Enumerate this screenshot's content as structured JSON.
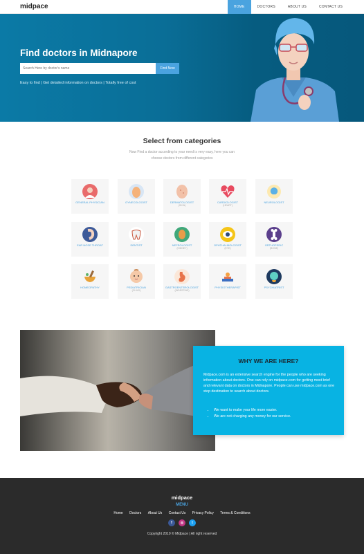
{
  "brand": "midpace",
  "nav": {
    "items": [
      "HOME",
      "DOCTORS",
      "ABOUT US",
      "CONTACT US"
    ],
    "active": "HOME"
  },
  "hero": {
    "title": "Find doctors in Midnapore",
    "search_placeholder": "Search Here by doctor's name",
    "search_button": "Find Now",
    "subtitle": "Easy to find | Get detailed information on doctors | Totally free of cost"
  },
  "categories": {
    "title": "Select from categories",
    "description": "Now Find a doctor according to your need is very easy, here you can choose doctors from different categories",
    "items": [
      {
        "label": "GENERAL PHYSICIAN",
        "sub": "",
        "icon": "general-physician-icon"
      },
      {
        "label": "GYNECOLOGIST",
        "sub": "",
        "icon": "gynecologist-icon"
      },
      {
        "label": "DERMATOLOGIST",
        "sub": "(SKIN)",
        "icon": "dermatologist-icon"
      },
      {
        "label": "CARDIOLOGIST",
        "sub": "(HEART)",
        "icon": "heart-icon"
      },
      {
        "label": "NEUROLOGIST",
        "sub": "",
        "icon": "brain-icon"
      },
      {
        "label": "EAR NOSE THROAT",
        "sub": "",
        "icon": "ent-icon"
      },
      {
        "label": "DENTIST",
        "sub": "",
        "icon": "tooth-icon"
      },
      {
        "label": "NEFROLOGIST",
        "sub": "(KIDNEY)",
        "icon": "kidney-icon"
      },
      {
        "label": "OPHTHALMOLOGIST",
        "sub": "(EYE)",
        "icon": "eye-icon"
      },
      {
        "label": "ORTHOPEDIC",
        "sub": "(BONE)",
        "icon": "bone-icon"
      },
      {
        "label": "HOMEOPATHY",
        "sub": "",
        "icon": "mortar-pestle-icon"
      },
      {
        "label": "PEDIATRICIAN",
        "sub": "(CHILD)",
        "icon": "baby-icon"
      },
      {
        "label": "GASTROENTEROLOGIST",
        "sub": "(INDESTINE)",
        "icon": "stomach-icon"
      },
      {
        "label": "PHYSIOTHERAPIST",
        "sub": "",
        "icon": "physiotherapy-icon"
      },
      {
        "label": "PSYCHIATRIST",
        "sub": "",
        "icon": "psychiatrist-icon"
      }
    ]
  },
  "about": {
    "heading": "WHY WE ARE HERE?",
    "text": "Midpace.com is an extensive search engine for the people who are seeking information about doctors. One can rely on midpace.com for getting most brief and relevant data on doctors in Midnapore. People can use midpace.com as one stop destination to search about doctors.",
    "points": [
      "We want to make your life more easier.",
      "We are not charging any money for our service."
    ]
  },
  "footer": {
    "logo": "midpace",
    "menu_title": "MENU",
    "links": [
      "Home",
      "Doctors",
      "About Us",
      "Contact Us",
      "Privacy Policy",
      "Terms & Conditions"
    ],
    "social": [
      {
        "icon": "facebook-icon",
        "glyph": "f",
        "color": "#3b5998"
      },
      {
        "icon": "instagram-icon",
        "glyph": "◎",
        "color": "#c13584"
      },
      {
        "icon": "twitter-icon",
        "glyph": "t",
        "color": "#1da1f2"
      }
    ],
    "copyright": "Copyright 2019 © Midpace | All right reserved"
  },
  "colors": {
    "accent": "#4aa3df",
    "hero": "#0a6e97",
    "about": "#08b3e3",
    "footer": "#2b2b2b"
  }
}
